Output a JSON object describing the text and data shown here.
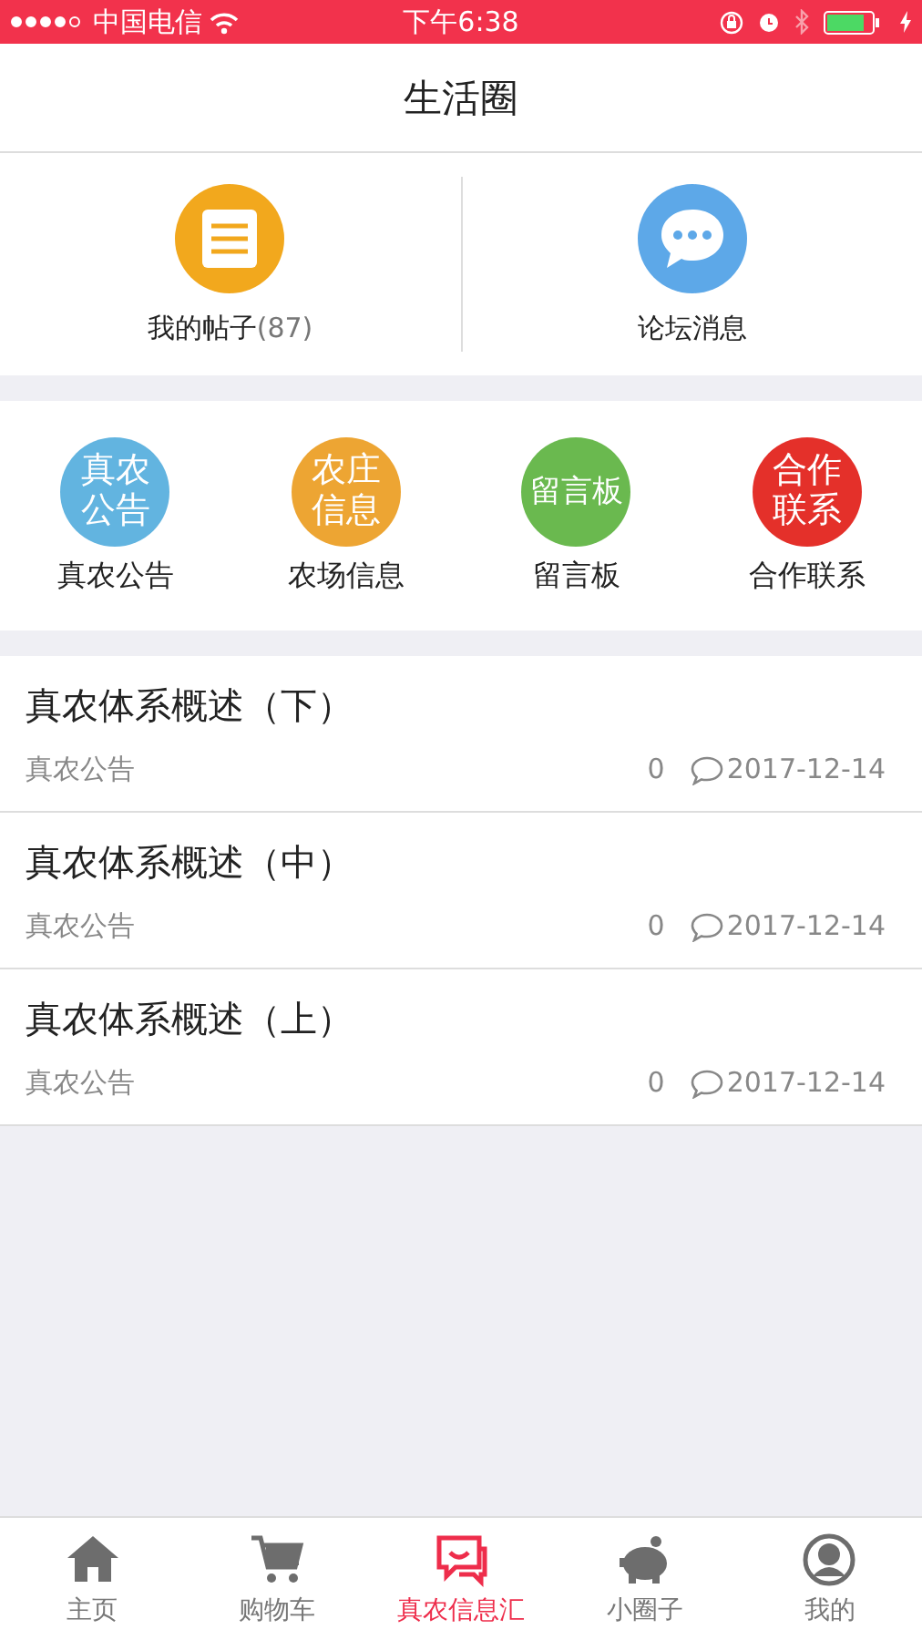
{
  "status_bar": {
    "signal_dots": [
      {
        "filled": true
      },
      {
        "filled": true
      },
      {
        "filled": true
      },
      {
        "filled": true
      },
      {
        "filled": false
      }
    ],
    "carrier": "中国电信",
    "time": "下午6:38"
  },
  "title": "生活圈",
  "top_actions": [
    {
      "kind": "posts",
      "label": "我的帖子",
      "count": "(87)"
    },
    {
      "kind": "messages",
      "label": "论坛消息"
    }
  ],
  "categories": [
    {
      "badge": [
        "真农",
        "公告"
      ],
      "label": "真农公告",
      "color": "#62b4e0"
    },
    {
      "badge": [
        "农庄",
        "信息"
      ],
      "label": "农场信息",
      "color": "#eda533"
    },
    {
      "badge": [
        "留言板"
      ],
      "label": "留言板",
      "color": "#6ab94f"
    },
    {
      "badge": [
        "合作",
        "联系"
      ],
      "label": "合作联系",
      "color": "#e4302a"
    }
  ],
  "posts": [
    {
      "title": "真农体系概述（下）",
      "category": "真农公告",
      "comments": "0",
      "date": "2017-12-14"
    },
    {
      "title": "真农体系概述（中）",
      "category": "真农公告",
      "comments": "0",
      "date": "2017-12-14"
    },
    {
      "title": "真农体系概述（上）",
      "category": "真农公告",
      "comments": "0",
      "date": "2017-12-14"
    }
  ],
  "tabs": [
    {
      "kind": "home",
      "label": "主页",
      "selected": false
    },
    {
      "kind": "cart",
      "label": "购物车",
      "selected": false
    },
    {
      "kind": "chat",
      "label": "真农信息汇",
      "selected": true
    },
    {
      "kind": "piggy",
      "label": "小圈子",
      "selected": false
    },
    {
      "kind": "user",
      "label": "我的",
      "selected": false
    }
  ]
}
